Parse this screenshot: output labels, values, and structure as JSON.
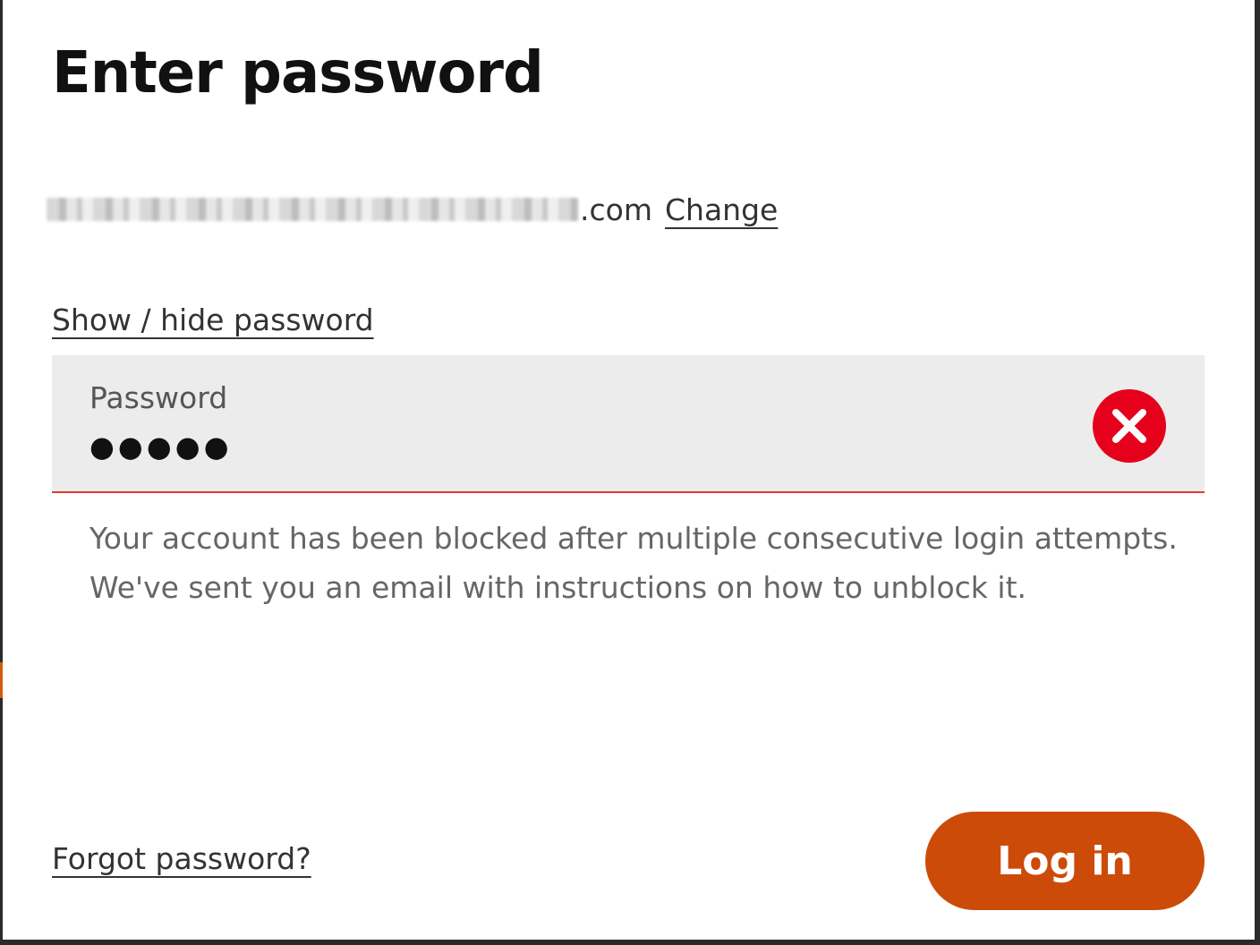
{
  "dialog": {
    "title": "Enter password"
  },
  "account": {
    "email_visible_suffix": ".com",
    "change_label": "Change"
  },
  "password": {
    "toggle_label": "Show / hide password",
    "label": "Password",
    "masked_value": "●●●●●",
    "error_message": "Your account has been blocked after multiple consecutive login attempts. We've sent you an email with instructions on how to unblock it."
  },
  "footer": {
    "forgot_label": "Forgot password?",
    "login_label": "Log in"
  },
  "icons": {
    "error": "error-x-circle-icon"
  },
  "colors": {
    "accent": "#cc4b09",
    "error": "#e5001c",
    "field_background": "#ececec"
  }
}
